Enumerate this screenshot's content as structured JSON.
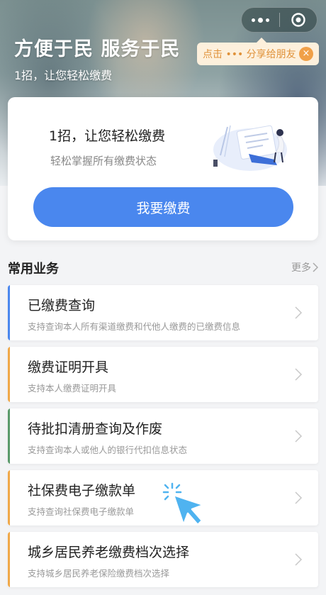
{
  "hero": {
    "title": "方便于民 服务于民",
    "subtitle": "1招，让您轻松缴费"
  },
  "share_tip": {
    "text": "点击 ••• 分享给朋友",
    "close": "×"
  },
  "pay_card": {
    "title": "1招，让您轻松缴费",
    "subtitle": "轻松掌握所有缴费状态",
    "button": "我要缴费"
  },
  "section": {
    "title": "常用业务",
    "more": "更多"
  },
  "items": [
    {
      "title": "已缴费查询",
      "desc": "支持查询本人所有渠道缴费和代他人缴费的已缴费信息",
      "accent": "#4a87ee"
    },
    {
      "title": "缴费证明开具",
      "desc": "支持本人缴费证明开具",
      "accent": "#f0a848"
    },
    {
      "title": "待批扣清册查询及作废",
      "desc": "支持查询本人或他人的银行代扣信息状态",
      "accent": "#5a9a6a"
    },
    {
      "title": "社保费电子缴款单",
      "desc": "支持查询社保费电子缴款单",
      "accent": "#f0a848"
    },
    {
      "title": "城乡居民养老缴费档次选择",
      "desc": "支持城乡居民养老保险缴费档次选择",
      "accent": "#f0a848"
    }
  ],
  "colors": {
    "primary": "#4a87ee",
    "tip_text": "#e0923a",
    "tip_bg": "#fdf0dc",
    "cursor": "#4fb3f0"
  }
}
